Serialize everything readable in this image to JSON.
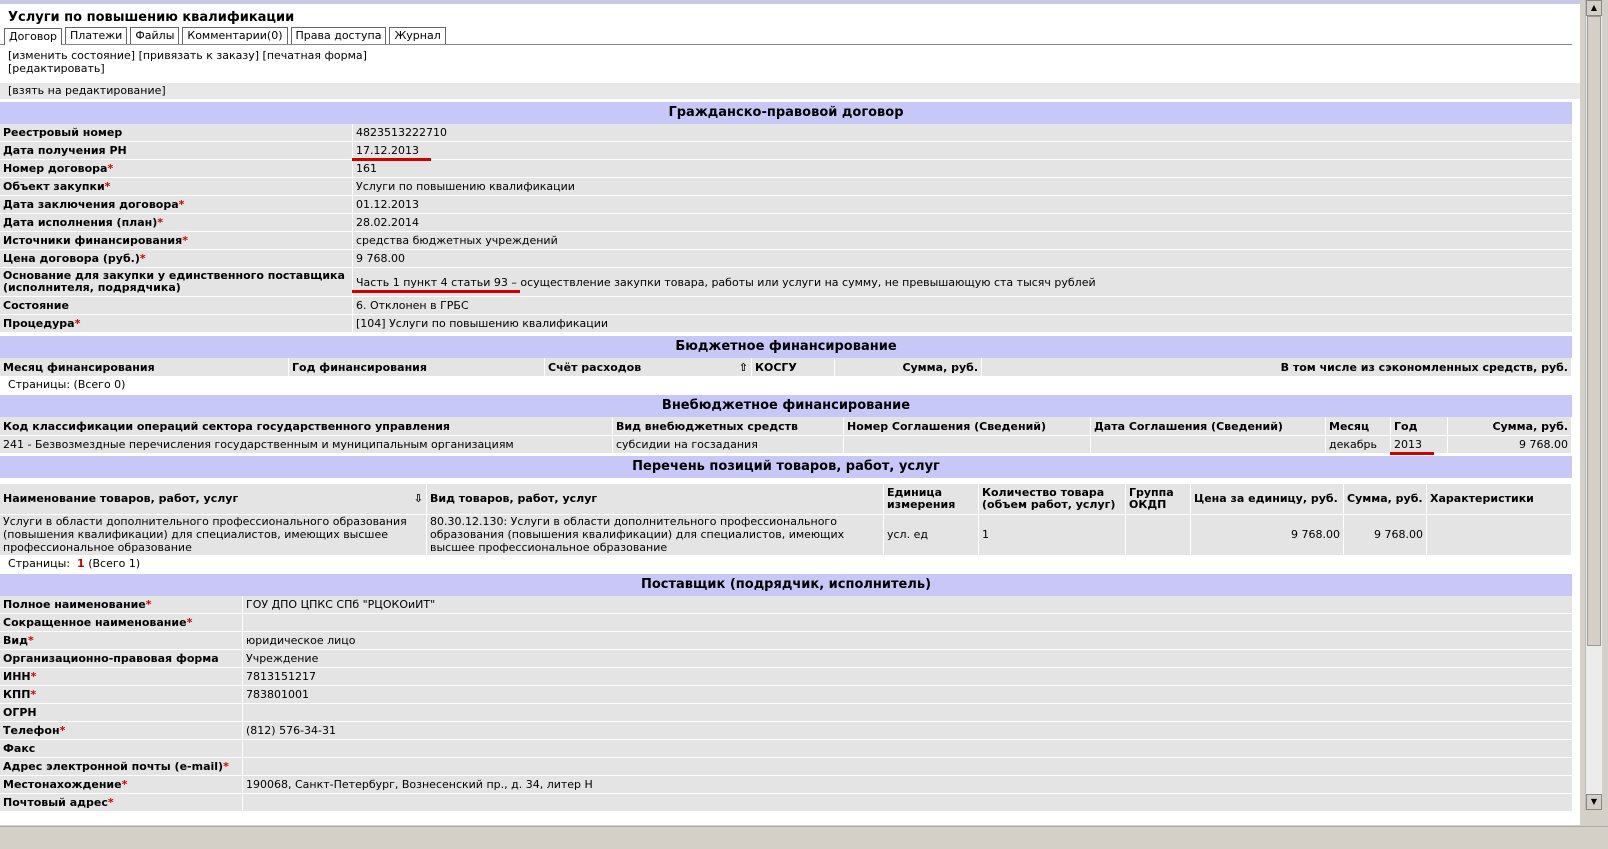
{
  "title": "Услуги по повышению квалификации",
  "tabs": [
    "Договор",
    "Платежи",
    "Файлы",
    "Комментарии(0)",
    "Права доступа",
    "Журнал"
  ],
  "actions": {
    "change_state": "[изменить состояние]",
    "link_order": "[привязать к заказу]",
    "print_form": "[печатная форма]",
    "edit": "[редактировать]",
    "take_edit": "[взять на редактирование]"
  },
  "contract": {
    "header": "Гражданско-правовой договор",
    "rows": [
      {
        "label": "Реестровый номер",
        "req": "",
        "value": "4823513222710"
      },
      {
        "label": "Дата получения РН",
        "req": "",
        "value": "17.12.2013"
      },
      {
        "label": "Номер договора",
        "req": "*",
        "value": "161"
      },
      {
        "label": "Объект закупки",
        "req": "*",
        "value": "Услуги по повышению квалификации"
      },
      {
        "label": "Дата заключения договора",
        "req": "*",
        "value": "01.12.2013"
      },
      {
        "label": "Дата исполнения (план)",
        "req": "*",
        "value": "28.02.2014"
      },
      {
        "label": "Источники финансирования",
        "req": "*",
        "value": "средства бюджетных учреждений"
      },
      {
        "label": "Цена договора (руб.)",
        "req": "*",
        "value": "9 768.00"
      }
    ],
    "basis_label_1": "Основание для закупки у единственного поставщика",
    "basis_label_2": "(исполнителя, подрядчика)",
    "basis_link": "Часть 1 пункт 4 статьи 93",
    "basis_text": " – осуществление закупки товара, работы или услуги на сумму, не превышающую ста тысяч рублей",
    "state_label": "Состояние",
    "state_value": "6. Отклонен в ГРБС",
    "procedure_label": "Процедура",
    "procedure_req": "*",
    "procedure_value": "[104] Услуги по повышению квалификации"
  },
  "budget": {
    "header": "Бюджетное финансирование",
    "columns": [
      "Месяц финансирования",
      "Год финансирования",
      "Счёт расходов",
      "КОСГУ",
      "Сумма, руб.",
      "В том числе из сэкономленных средств, руб."
    ],
    "pages": "Страницы:  (Всего 0)"
  },
  "offbudget": {
    "header": "Внебюджетное финансирование",
    "columns": [
      "Код классификации операций сектора государственного управления",
      "Вид внебюджетных средств",
      "Номер Соглашения (Сведений)",
      "Дата Соглашения (Сведений)",
      "Месяц",
      "Год",
      "Сумма, руб."
    ],
    "row": [
      "241 - Безвозмездные перечисления государственным и муниципальным организациям",
      "субсидии на госзадания",
      "",
      "",
      "декабрь",
      "2013",
      "9 768.00"
    ]
  },
  "goods": {
    "header": "Перечень позиций товаров, работ, услуг",
    "columns": [
      "Наименование товаров, работ, услуг",
      "Вид товаров, работ, услуг",
      "Единица измерения",
      "Количество товара (объем работ, услуг)",
      "Группа ОКДП",
      "Цена за единицу, руб.",
      "Сумма, руб.",
      "Характеристики"
    ],
    "row": {
      "name": "Услуги в области дополнительного профессионального образования (повышения квалификации) для специалистов, имеющих высшее профессиональное образование",
      "kind": "80.30.12.130: Услуги в области дополнительного профессионального образования (повышения квалификации) для специалистов, имеющих высшее профессиональное образование",
      "unit": "усл. ед",
      "qty": "1",
      "okdp": "",
      "price": "9 768.00",
      "sum": "9 768.00",
      "chars": ""
    },
    "pages_prefix": "Страницы:",
    "pages_current": "1",
    "pages_total": "(Всего 1)"
  },
  "supplier": {
    "header": "Поставщик (подрядчик, исполнитель)",
    "rows": [
      {
        "label": "Полное наименование",
        "req": "*",
        "value": "ГОУ ДПО ЦПКС СПб \"РЦОКОиИТ\""
      },
      {
        "label": "Сокращенное наименование",
        "req": "*",
        "value": ""
      },
      {
        "label": "Вид",
        "req": "*",
        "value": "юридическое лицо"
      },
      {
        "label": "Организационно-правовая форма",
        "req": "",
        "value": "Учреждение"
      },
      {
        "label": "ИНН",
        "req": "*",
        "value": "7813151217"
      },
      {
        "label": "КПП",
        "req": "*",
        "value": "783801001"
      },
      {
        "label": "ОГРН",
        "req": "",
        "value": ""
      },
      {
        "label": "Телефон",
        "req": "*",
        "value": "(812) 576-34-31"
      },
      {
        "label": "Факс",
        "req": "",
        "value": ""
      },
      {
        "label": "Адрес электронной почты (e-mail)",
        "req": "*",
        "value": ""
      },
      {
        "label": "Местонахождение",
        "req": "*",
        "value": "190068, Санкт-Петербург, Вознесенский пр., д. 34, литер Н"
      },
      {
        "label": "Почтовый адрес",
        "req": "*",
        "value": ""
      }
    ]
  }
}
